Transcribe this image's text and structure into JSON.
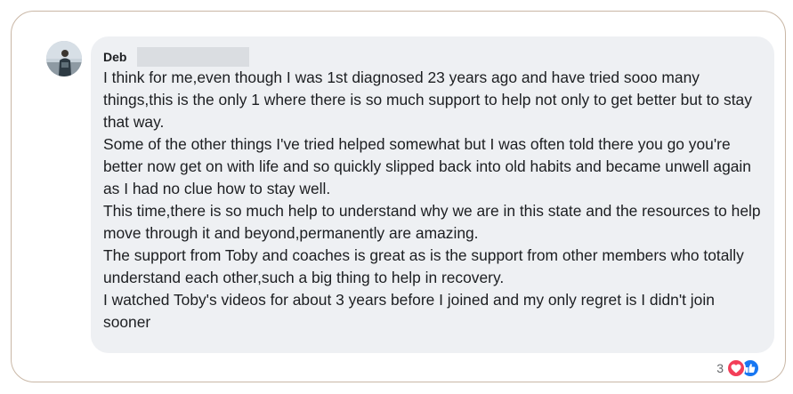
{
  "comment": {
    "author": "Deb",
    "avatar_icon": "profile-photo",
    "paragraphs": [
      "I think for me,even though I was 1st diagnosed 23 years ago and have tried sooo many things,this is the only 1 where there is so much support to help not only to get better but to stay that way.",
      "Some of the other things I've tried helped somewhat but I was often told there you go you're better now get on with life and so quickly slipped back into old habits and became unwell again as I had no clue how to stay well.",
      "This time,there is so much help to understand why we are in this state and the resources to help move through it and beyond,permanently are amazing.",
      "The support from Toby and coaches is great as is the support from other members who totally understand each other,such a big thing to help in recovery.",
      "I watched Toby's videos for about 3 years before I joined and my only regret is I didn't join sooner"
    ]
  },
  "reactions": {
    "count": "3",
    "icons": [
      "love-icon",
      "like-icon"
    ],
    "colors": {
      "love": "#f33e58",
      "like": "#1877f2"
    }
  },
  "colors": {
    "frame_border": "#c9b7a6",
    "bubble_bg": "#eef0f3",
    "redaction": "#dadde1",
    "text": "#1c1e21"
  }
}
